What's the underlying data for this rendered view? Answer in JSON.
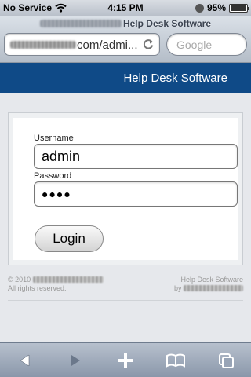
{
  "status_bar": {
    "carrier": "No Service",
    "time": "4:15 PM",
    "battery": "95%",
    "battery_level": 0.95
  },
  "browser": {
    "page_title": "Help Desk Software",
    "url": "com/admi...",
    "search_placeholder": "Google"
  },
  "header": {
    "title": "Help Desk Software"
  },
  "login": {
    "username_label": "Username",
    "username_value": "admin",
    "password_label": "Password",
    "password_mask": "●●●●",
    "login_label": "Login"
  },
  "footer": {
    "copyright": "© 2010",
    "rights": "All rights reserved.",
    "product": "Help Desk Software",
    "by": "by"
  },
  "toolbar": {
    "items": [
      "back-icon",
      "forward-icon",
      "add-icon",
      "bookmarks-icon",
      "pages-icon"
    ]
  }
}
